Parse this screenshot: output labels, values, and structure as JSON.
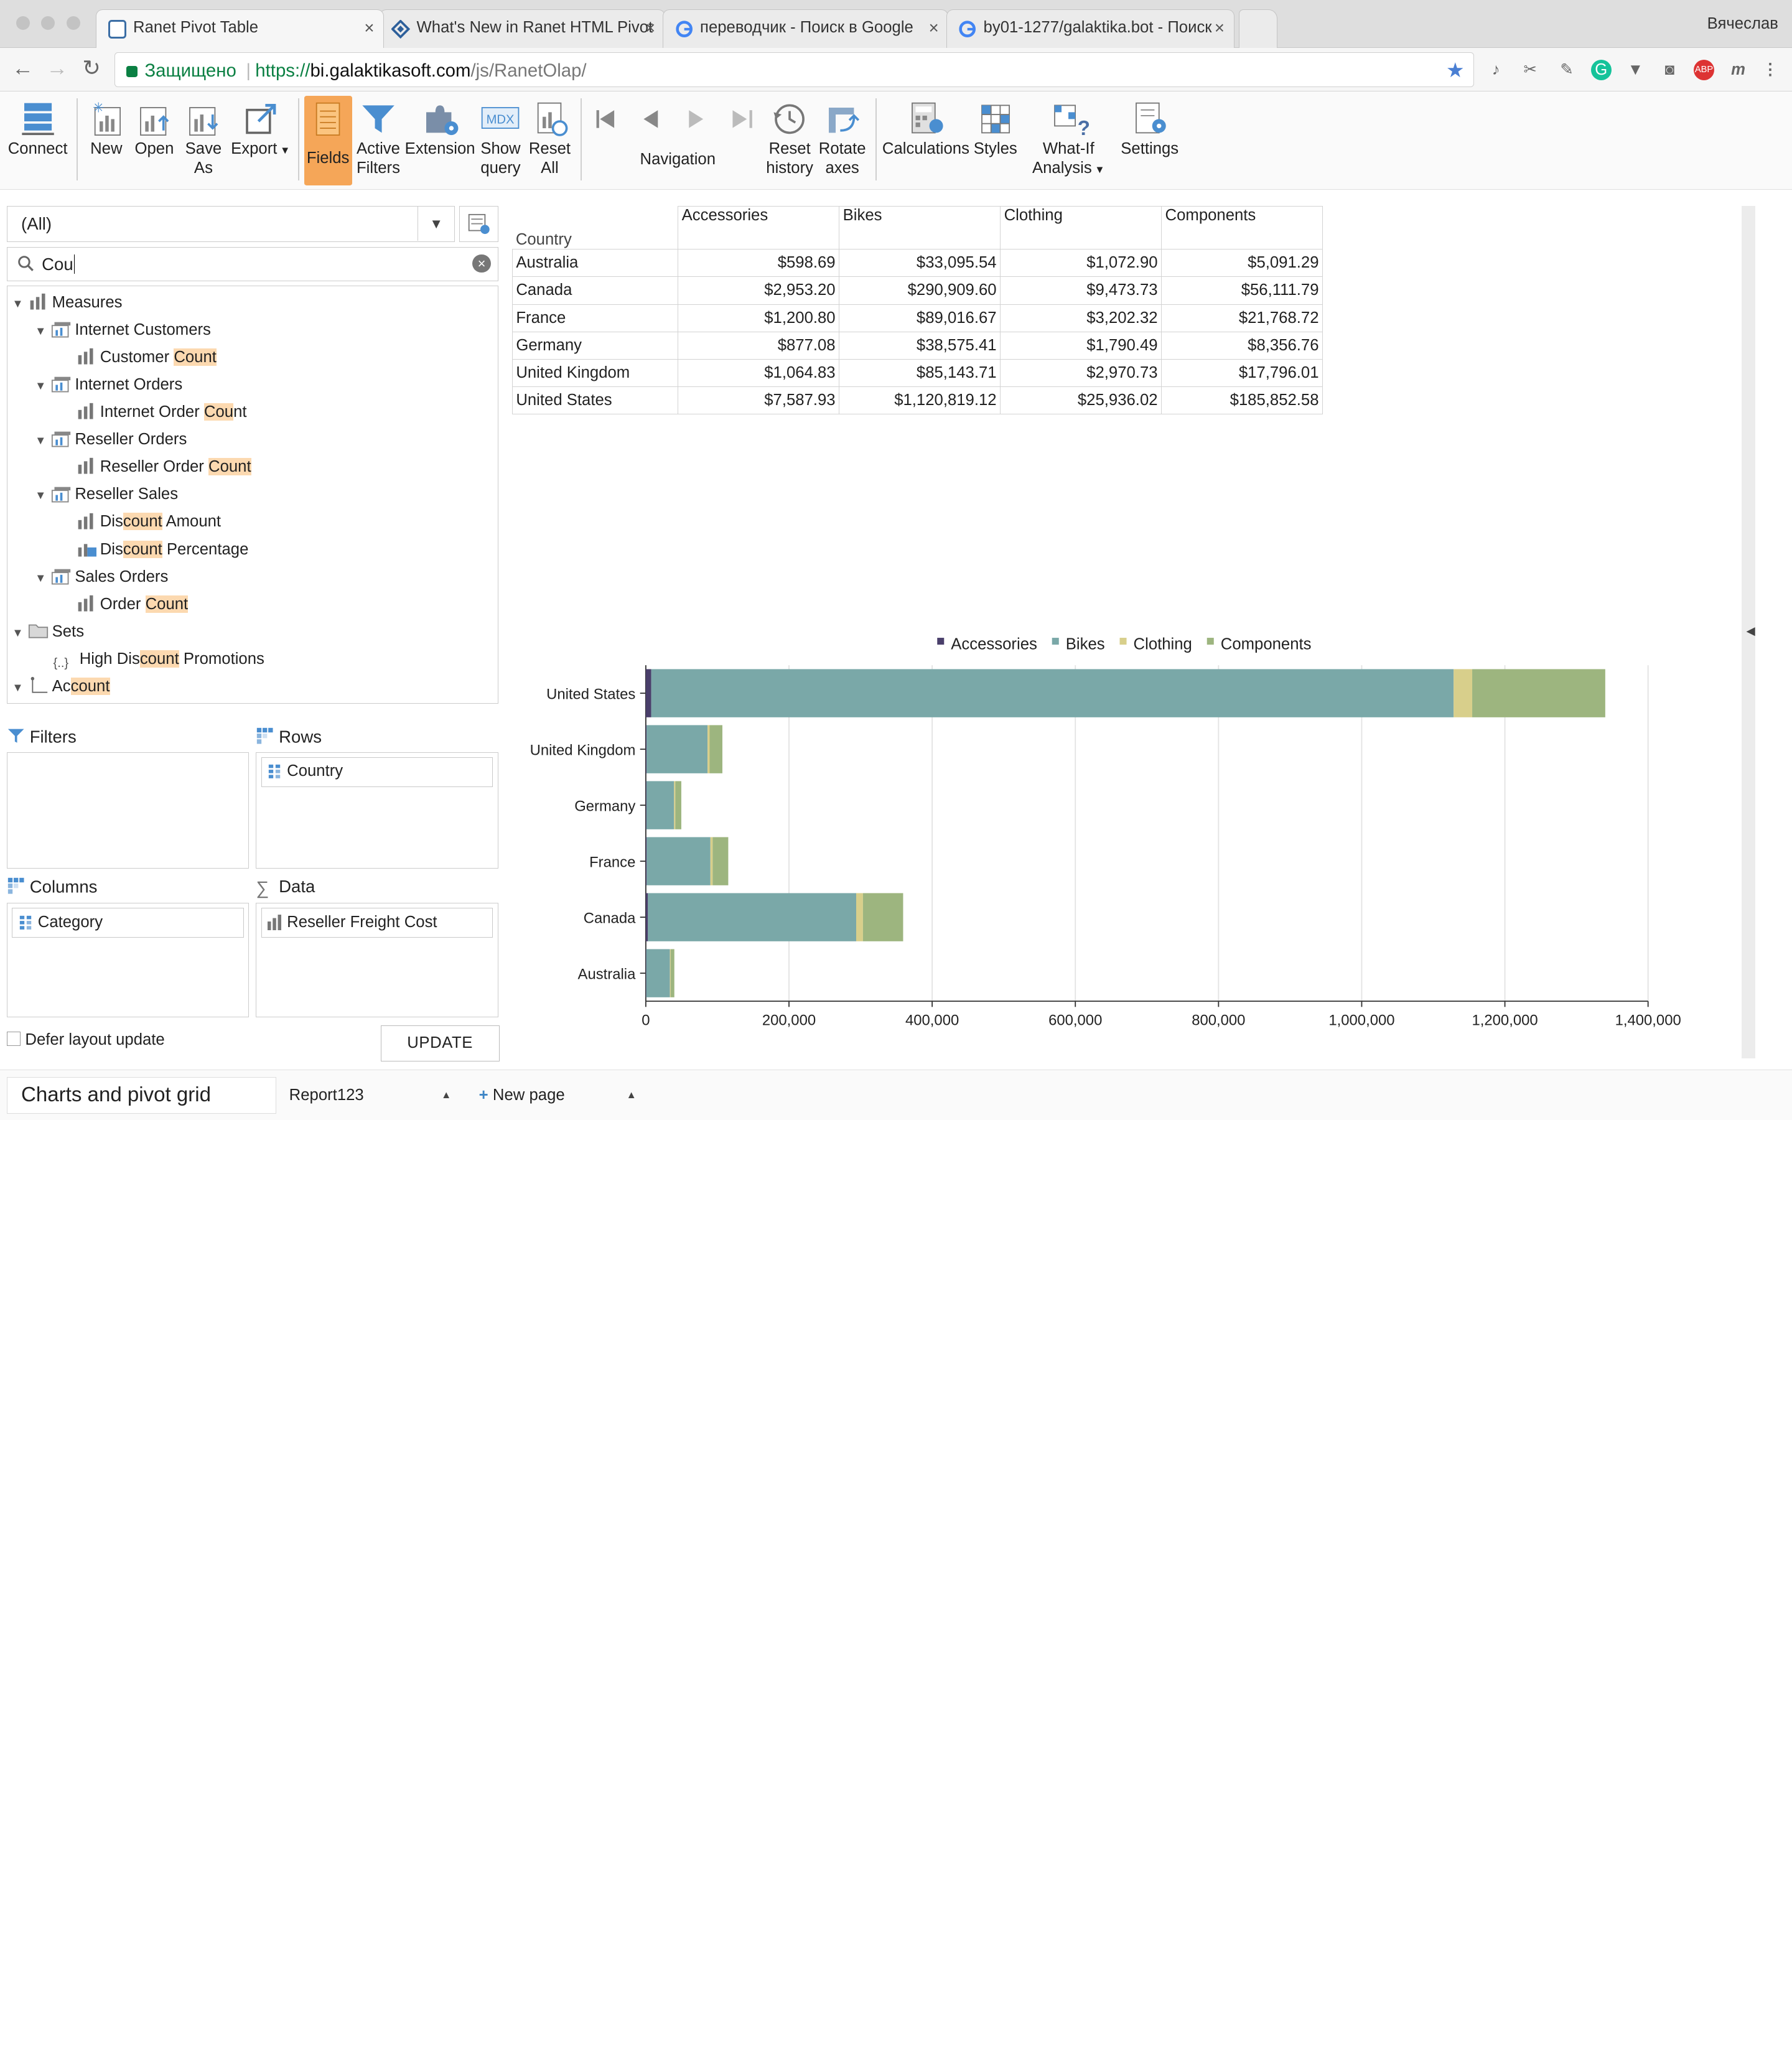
{
  "browser": {
    "tabs": [
      {
        "title": "Ranet Pivot Table",
        "favicon_color": "#3b6ea5"
      },
      {
        "title": "What's New in Ranet HTML Pivot",
        "favicon_color": "#2d5f9a"
      },
      {
        "title": "переводчик - Поиск в Google",
        "favicon_color": "#4285f4"
      },
      {
        "title": "by01-1277/galaktika.bot - Поиск",
        "favicon_color": "#4285f4"
      }
    ],
    "user_name": "Вячеслав",
    "secure_label": "Защищено",
    "url_scheme": "https://",
    "url_host": "bi.galaktikasoft.com",
    "url_path": "/js/RanetOlap/"
  },
  "ribbon": {
    "connect": "Connect",
    "new": "New",
    "open": "Open",
    "save_as_1": "Save",
    "save_as_2": "As",
    "export": "Export",
    "fields": "Fields",
    "active_filters_1": "Active",
    "active_filters_2": "Filters",
    "extension": "Extension",
    "show_query_1": "Show",
    "show_query_2": "query",
    "reset_all_1": "Reset",
    "reset_all_2": "All",
    "navigation": "Navigation",
    "reset_history_1": "Reset",
    "reset_history_2": "history",
    "rotate_axes_1": "Rotate",
    "rotate_axes_2": "axes",
    "calculations": "Calculations",
    "styles": "Styles",
    "what_if_1": "What-If",
    "what_if_2": "Analysis",
    "settings": "Settings",
    "mdx_badge": "MDX"
  },
  "left_panel": {
    "cube_select": "(All)",
    "search_value": "Cou",
    "tree": {
      "measures": "Measures",
      "internet_customers": "Internet Customers",
      "customer_count_a": "Customer ",
      "customer_count_b": "Count",
      "internet_orders": "Internet Orders",
      "internet_order_count_a": "Internet Order ",
      "internet_order_count_b": "Cou",
      "internet_order_count_c": "nt",
      "reseller_orders": "Reseller Orders",
      "reseller_order_count_a": "Reseller Order ",
      "reseller_order_count_b": "Count",
      "reseller_sales": "Reseller Sales",
      "discount_amount_a": "Dis",
      "discount_amount_b": "count",
      "discount_amount_c": " Amount",
      "discount_pct_a": "Dis",
      "discount_pct_b": "count",
      "discount_pct_c": " Percentage",
      "sales_orders": "Sales Orders",
      "order_count_a": "Order ",
      "order_count_b": "Count",
      "sets": "Sets",
      "high_disc_a": "High Dis",
      "high_disc_b": "count",
      "high_disc_c": " Promotions",
      "account_a": "Ac",
      "account_b": "count",
      "set_glyph": "{..}"
    },
    "zones": {
      "filters": "Filters",
      "rows": "Rows",
      "columns": "Columns",
      "data": "Data",
      "rows_item": "Country",
      "columns_item": "Category",
      "data_item": "Reseller Freight Cost"
    },
    "defer_label": "Defer layout update",
    "update_label": "UPDATE"
  },
  "pivot": {
    "row_header": "Country",
    "columns": [
      "Accessories",
      "Bikes",
      "Clothing",
      "Components"
    ],
    "rows": [
      {
        "country": "Australia",
        "values": [
          "$598.69",
          "$33,095.54",
          "$1,072.90",
          "$5,091.29"
        ]
      },
      {
        "country": "Canada",
        "values": [
          "$2,953.20",
          "$290,909.60",
          "$9,473.73",
          "$56,111.79"
        ]
      },
      {
        "country": "France",
        "values": [
          "$1,200.80",
          "$89,016.67",
          "$3,202.32",
          "$21,768.72"
        ]
      },
      {
        "country": "Germany",
        "values": [
          "$877.08",
          "$38,575.41",
          "$1,790.49",
          "$8,356.76"
        ]
      },
      {
        "country": "United Kingdom",
        "values": [
          "$1,064.83",
          "$85,143.71",
          "$2,970.73",
          "$17,796.01"
        ]
      },
      {
        "country": "United States",
        "values": [
          "$7,587.93",
          "$1,120,819.12",
          "$25,936.02",
          "$185,852.58"
        ]
      }
    ]
  },
  "chart_data": {
    "type": "bar",
    "orientation": "horizontal",
    "stacked": true,
    "categories": [
      "United States",
      "United Kingdom",
      "Germany",
      "France",
      "Canada",
      "Australia"
    ],
    "series": [
      {
        "name": "Accessories",
        "color": "#4a3f6b",
        "values": [
          7587.93,
          1064.83,
          877.08,
          1200.8,
          2953.2,
          598.69
        ]
      },
      {
        "name": "Bikes",
        "color": "#7aa8a8",
        "values": [
          1120819.12,
          85143.71,
          38575.41,
          89016.67,
          290909.6,
          33095.54
        ]
      },
      {
        "name": "Clothing",
        "color": "#d8cf8b",
        "values": [
          25936.02,
          2970.73,
          1790.49,
          3202.32,
          9473.73,
          1072.9
        ]
      },
      {
        "name": "Components",
        "color": "#9db57f",
        "values": [
          185852.58,
          17796.01,
          8356.76,
          21768.72,
          56111.79,
          5091.29
        ]
      }
    ],
    "xlim": [
      0,
      1400000
    ],
    "xticks": [
      0,
      200000,
      400000,
      600000,
      800000,
      1000000,
      1200000,
      1400000
    ],
    "xtick_labels": [
      "0",
      "200,000",
      "400,000",
      "600,000",
      "800,000",
      "1,000,000",
      "1,200,000",
      "1,400,000"
    ],
    "grid": true,
    "legend": "top"
  },
  "bottom": {
    "current_page": "Charts and pivot grid",
    "report_tab": "Report123",
    "new_page": "New page"
  }
}
